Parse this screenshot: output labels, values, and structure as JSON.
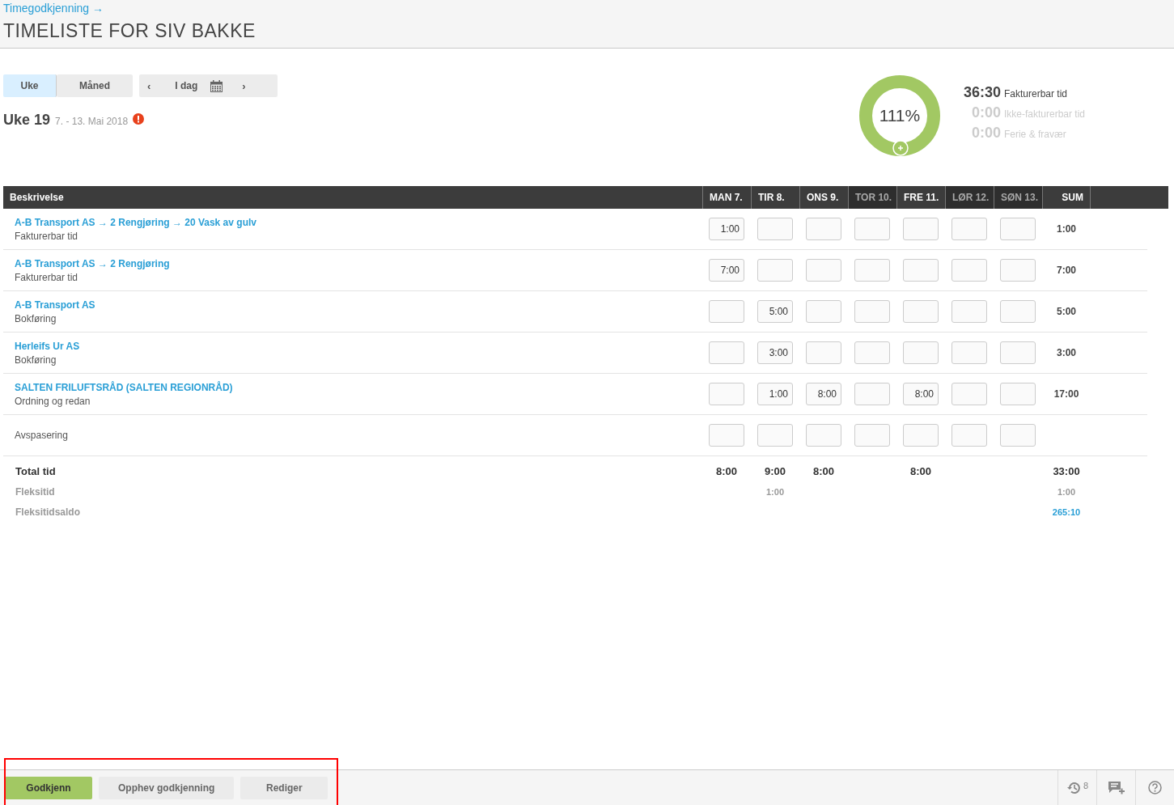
{
  "breadcrumb": "Timegodkjenning →",
  "title": "TIMELISTE FOR SIV BAKKE",
  "view_tabs": [
    {
      "label": "Uke",
      "selected": true
    },
    {
      "label": "Måned",
      "selected": false
    }
  ],
  "nav": {
    "prev": "‹",
    "today": "I dag",
    "next": "›"
  },
  "week": {
    "label": "Uke 19",
    "range": "7. - 13. Mai 2018",
    "warning": true
  },
  "summary": {
    "percent": "111%",
    "items": [
      {
        "value": "36:30",
        "label": "Fakturerbar tid",
        "active": true
      },
      {
        "value": "0:00",
        "label": "Ikke-fakturerbar tid",
        "active": false
      },
      {
        "value": "0:00",
        "label": "Ferie & fravær",
        "active": false
      }
    ]
  },
  "table": {
    "description_header": "Beskrivelse",
    "sum_header": "SUM",
    "days": [
      {
        "label": "MAN 7.",
        "workday": true,
        "total": "8:00"
      },
      {
        "label": "TIR 8.",
        "workday": true,
        "total": "9:00",
        "flex": "1:00"
      },
      {
        "label": "ONS 9.",
        "workday": true,
        "total": "8:00"
      },
      {
        "label": "TOR 10.",
        "workday": false
      },
      {
        "label": "FRE 11.",
        "workday": true,
        "total": "8:00"
      },
      {
        "label": "LØR 12.",
        "workday": false
      },
      {
        "label": "SØN 13.",
        "workday": false
      }
    ],
    "rows": [
      {
        "kind": "project",
        "title": "A-B Transport AS → 2 Rengjøring → 20 Vask av gulv",
        "subtitle": "Fakturerbar tid",
        "cells": [
          {
            "value": "1:00"
          },
          {},
          {},
          {},
          {},
          {},
          {}
        ],
        "sum": "1:00"
      },
      {
        "kind": "project",
        "title": "A-B Transport AS → 2 Rengjøring",
        "subtitle": "Fakturerbar tid",
        "cells": [
          {
            "value": "7:00"
          },
          {},
          {},
          {},
          {},
          {},
          {}
        ],
        "sum": "7:00"
      },
      {
        "kind": "project",
        "title": "A-B Transport AS",
        "subtitle": "Bokføring",
        "cells": [
          {},
          {
            "value": "5:00"
          },
          {},
          {},
          {},
          {},
          {}
        ],
        "sum": "5:00"
      },
      {
        "kind": "project",
        "title": "Herleifs Ur AS",
        "subtitle": "Bokføring",
        "cells": [
          {},
          {
            "value": "3:00"
          },
          {},
          {},
          {},
          {},
          {}
        ],
        "sum": "3:00"
      },
      {
        "kind": "project",
        "title": "SALTEN FRILUFTSRÅD (SALTEN REGIONRÅD)",
        "subtitle": "Ordning og redan",
        "cells": [
          {},
          {
            "value": "1:00"
          },
          {
            "value": "8:00"
          },
          {},
          {
            "value": "8:00"
          },
          {},
          {}
        ],
        "sum": "17:00"
      },
      {
        "kind": "plain",
        "subtitle": "Avspasering",
        "cells": [
          {},
          {},
          {},
          {},
          {},
          {},
          {}
        ]
      }
    ],
    "totals": [
      {
        "kind": "total",
        "label": "Total tid",
        "sum": "33:00"
      },
      {
        "kind": "secondary",
        "label": "Fleksitid",
        "sum": "1:00"
      },
      {
        "kind": "balance",
        "label": "Fleksitidsaldo",
        "sum": "265:10"
      }
    ]
  },
  "footer": {
    "buttons": [
      {
        "label": "Godkjenn",
        "primary": true
      },
      {
        "label": "Opphev godkjenning",
        "primary": false
      },
      {
        "label": "Rediger",
        "primary": false
      }
    ],
    "history_count": "8"
  }
}
